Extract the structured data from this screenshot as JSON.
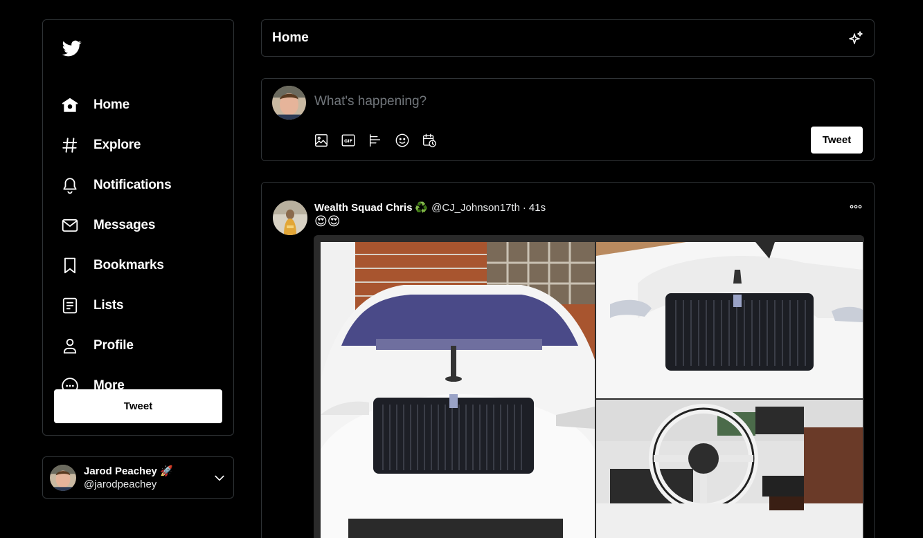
{
  "sidebar": {
    "items": [
      {
        "label": "Home"
      },
      {
        "label": "Explore"
      },
      {
        "label": "Notifications"
      },
      {
        "label": "Messages"
      },
      {
        "label": "Bookmarks"
      },
      {
        "label": "Lists"
      },
      {
        "label": "Profile"
      },
      {
        "label": "More"
      }
    ],
    "tweet_label": "Tweet"
  },
  "account": {
    "name": "Jarod Peachey 🚀",
    "handle": "@jarodpeachey"
  },
  "header": {
    "title": "Home"
  },
  "composer": {
    "placeholder": "What's happening?",
    "tweet_label": "Tweet",
    "tools": [
      "image-icon",
      "gif-icon",
      "poll-icon",
      "emoji-icon",
      "schedule-icon"
    ]
  },
  "tweet": {
    "author": "Wealth Squad Chris",
    "badge": "♻️",
    "handle": "@CJ_Johnson17th",
    "separator": "·",
    "time": "41s",
    "text": "😍😍",
    "media_count": 3
  },
  "colors": {
    "background": "#000000",
    "border": "#2f3336",
    "button_bg": "#ffffff",
    "button_text": "#000000",
    "placeholder": "#71767b"
  }
}
